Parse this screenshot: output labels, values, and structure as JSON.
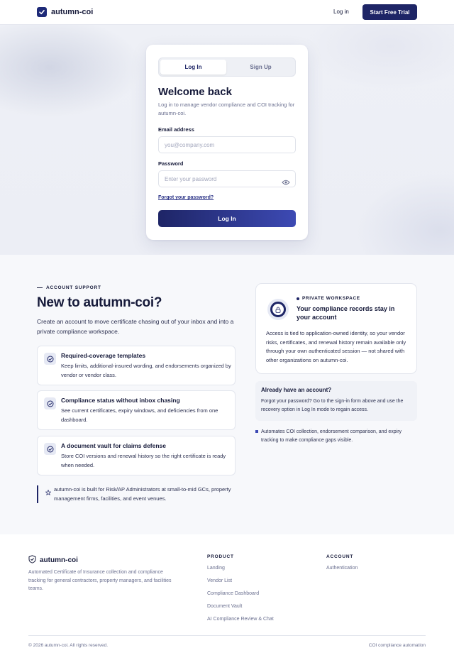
{
  "header": {
    "brand": "autumn-coi",
    "login_link": "Log in",
    "trial_button": "Start Free Trial"
  },
  "auth_card": {
    "tabs": [
      {
        "label": "Log In",
        "active": true
      },
      {
        "label": "Sign Up",
        "active": false
      }
    ],
    "title": "Welcome back",
    "subtitle": "Log in to manage vendor compliance and COI tracking for autumn-coi.",
    "email_label": "Email address",
    "email_placeholder": "you@company.com",
    "email_value": "",
    "password_label": "Password",
    "password_placeholder": "Enter your password",
    "password_value": "",
    "forgot_link": "Forgot your password?",
    "submit_label": "Log In"
  },
  "support": {
    "eyebrow": "ACCOUNT SUPPORT",
    "title": "New to autumn-coi?",
    "lead": "Create an account to move certificate chasing out of your inbox and into a private compliance workspace.",
    "features": [
      {
        "title": "Required-coverage templates",
        "desc": "Keep limits, additional-insured wording, and endorsements organized by vendor or vendor class."
      },
      {
        "title": "Compliance status without inbox chasing",
        "desc": "See current certificates, expiry windows, and deficiencies from one dashboard."
      },
      {
        "title": "A document vault for claims defense",
        "desc": "Store COI versions and renewal history so the right certificate is ready when needed."
      }
    ],
    "quote": "autumn-coi is built for Risk/AP Administrators at small-to-mid GCs, property management firms, facilities, and event venues."
  },
  "workspace": {
    "eyebrow": "PRIVATE WORKSPACE",
    "title": "Your compliance records stay in your account",
    "body": "Access is tied to application-owned identity, so your vendor risks, certificates, and renewal history remain available only through your own authenticated session — not shared with other organizations on autumn-coi."
  },
  "have_account": {
    "title": "Already have an account?",
    "body": "Forgot your password? Go to the sign-in form above and use the recovery option in Log In mode to regain access."
  },
  "automation_note": "Automates COI collection, endorsement comparison, and expiry tracking to make compliance gaps visible.",
  "footer": {
    "brand": "autumn-coi",
    "description": "Automated Certificate of Insurance collection and compliance tracking for general contractors, property managers, and facilities teams.",
    "product_heading": "PRODUCT",
    "product_links": [
      "Landing",
      "Vendor List",
      "Compliance Dashboard",
      "Document Vault",
      "AI Compliance Review & Chat"
    ],
    "account_heading": "ACCOUNT",
    "account_links": [
      "Authentication"
    ],
    "copyright": "© 2026 autumn-coi. All rights reserved.",
    "tagline": "COI compliance automation"
  },
  "colors": {
    "brand_navy": "#1e2566",
    "accent_blue": "#3d4ab4",
    "muted_text": "#6b7090"
  }
}
